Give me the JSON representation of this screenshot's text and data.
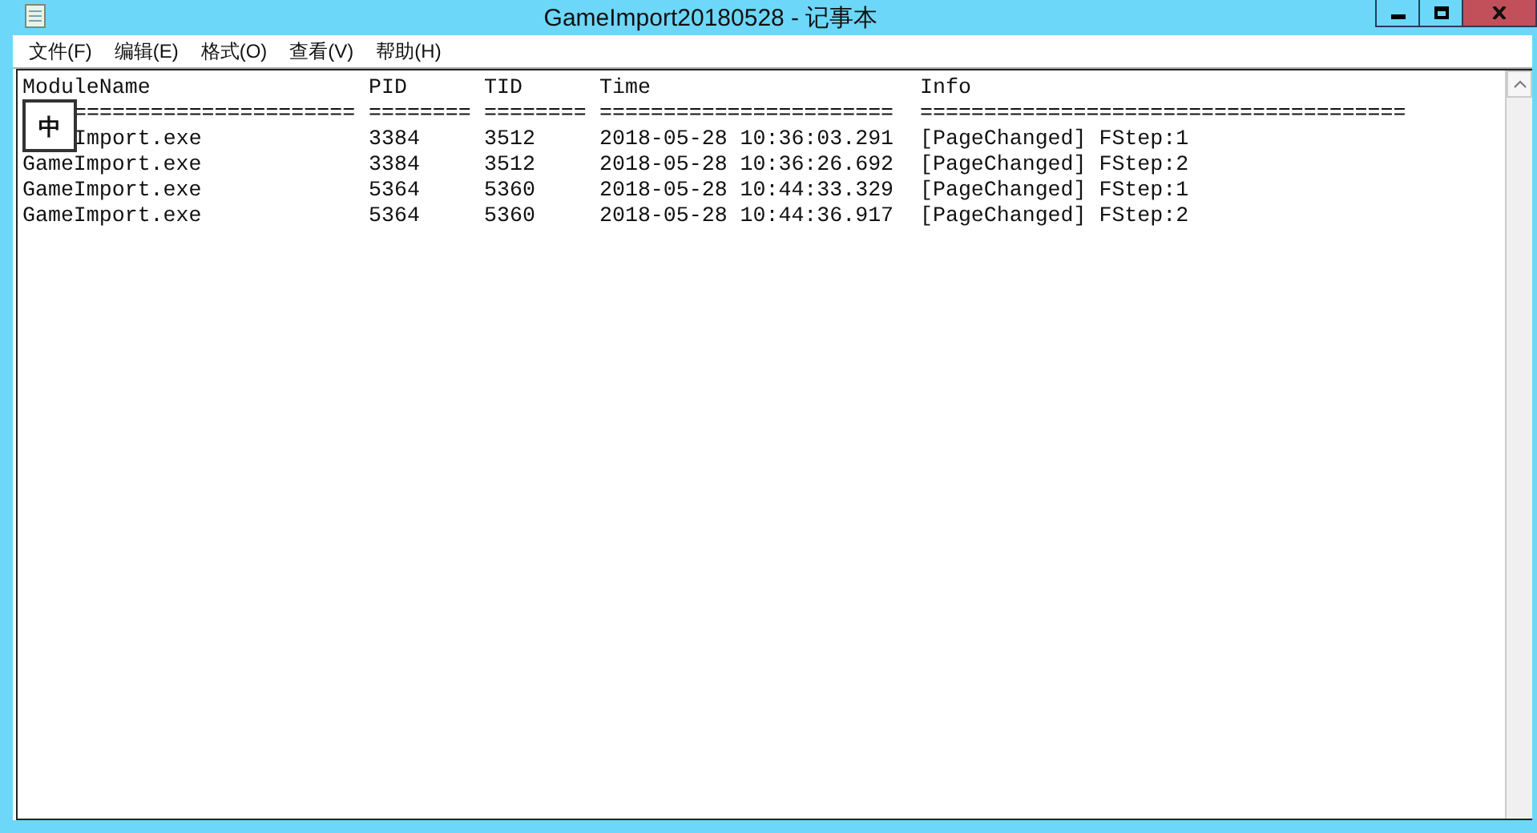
{
  "window": {
    "title": "GameImport20180528 - 记事本"
  },
  "menu": [
    "文件(F)",
    "编辑(E)",
    "格式(O)",
    "查看(V)",
    "帮助(H)"
  ],
  "editor": {
    "header": [
      "ModuleName",
      "PID",
      "TID",
      "Time",
      "Info"
    ],
    "separators": [
      "======================",
      "========",
      "========",
      "=======================",
      "======================================"
    ],
    "rows": [
      [
        "Import.exe",
        "3384",
        "3512",
        "2018-05-28 10:36:03.291",
        "[PageChanged] FStep:1"
      ],
      [
        "GameImport.exe",
        "3384",
        "3512",
        "2018-05-28 10:36:26.692",
        "[PageChanged] FStep:2"
      ],
      [
        "GameImport.exe",
        "5364",
        "5360",
        "2018-05-28 10:44:33.329",
        "[PageChanged] FStep:1"
      ],
      [
        "GameImport.exe",
        "5364",
        "5360",
        "2018-05-28 10:44:36.917",
        "[PageChanged] FStep:2"
      ]
    ]
  },
  "ime_indicator": "中"
}
